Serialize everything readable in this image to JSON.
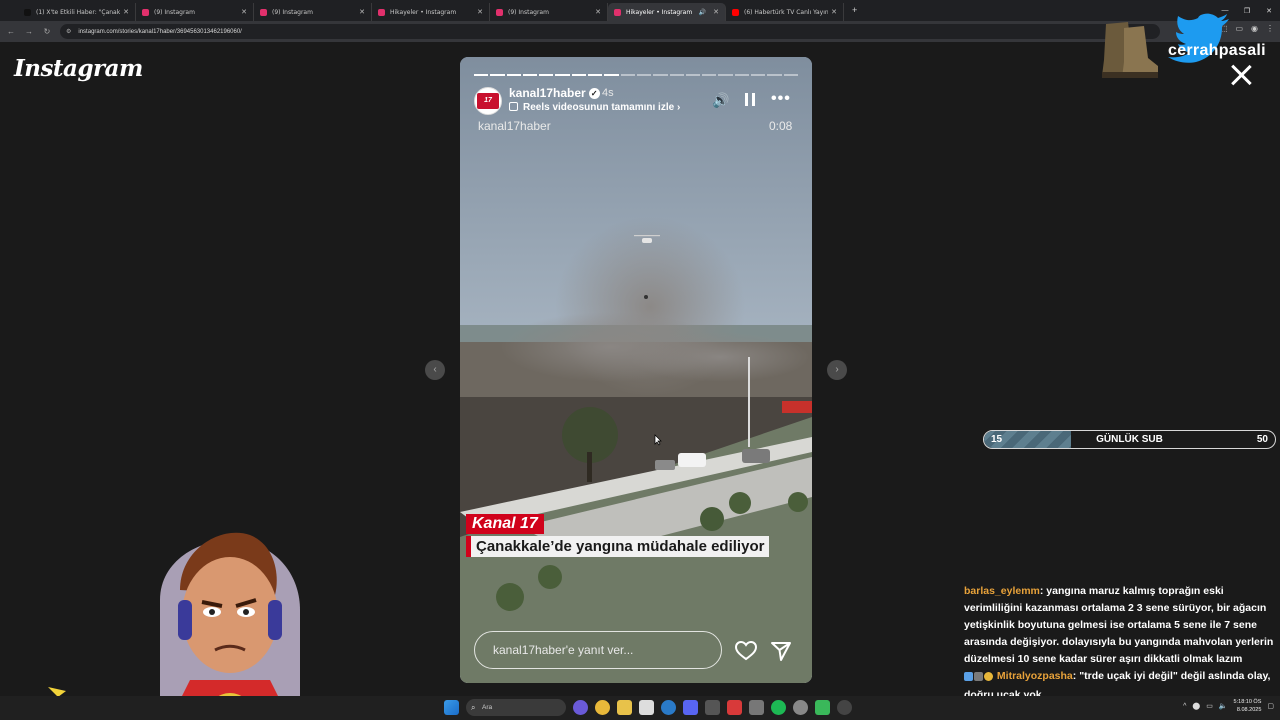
{
  "browser": {
    "tabs": [
      {
        "title": "(1) X'te Etkili Haber: \"Çanakkale",
        "favicon_color": "#111111",
        "active": false
      },
      {
        "title": "(9) Instagram",
        "favicon_color": "#e1306c",
        "active": false
      },
      {
        "title": "(9) Instagram",
        "favicon_color": "#e1306c",
        "active": false
      },
      {
        "title": "Hikayeler • Instagram",
        "favicon_color": "#e1306c",
        "active": false
      },
      {
        "title": "(9) Instagram",
        "favicon_color": "#e1306c",
        "active": false
      },
      {
        "title": "Hikayeler • Instagram",
        "favicon_color": "#e1306c",
        "active": true,
        "audio": true
      },
      {
        "title": "(6) Habertürk TV Canlı Yayın ᴴᴰ",
        "favicon_color": "#ff0000",
        "active": false
      }
    ],
    "new_tab": "+",
    "url": "instagram.com/stories/kanal17haber/3694563013462196060/"
  },
  "instagram": {
    "logo": "Instagram",
    "story": {
      "username": "kanal17haber",
      "avatar_text": "17",
      "time_ago": "4s",
      "reels_link": "Reels videosunun tamamını izle",
      "watermark_user": "kanal17haber",
      "video_time": "0:08",
      "channel_tag": "Kanal 17",
      "headline": "Çanakkale’de yangına müdahale ediliyor",
      "reply_placeholder": "kanal17haber'e yanıt ver...",
      "progress_total": 20,
      "progress_done": 9
    }
  },
  "overlay": {
    "brand_name": "cerrahpasali",
    "sub_goal": {
      "current": "15",
      "label": "GÜNLÜK SUB",
      "goal": "50",
      "fraction": 0.3
    },
    "chat": [
      {
        "user": "barlas_eylemm",
        "message": ": yangına maruz kalmış toprağın eski verimliliğini kazanması ortalama 2 3 sene sürüyor, bir ağacın yetişkinlik boyutuna gelmesi ise ortalama 5 sene ile 7 sene arasında değişiyor. dolayısıyla bu yangında mahvolan yerlerin düzelmesi 10 sene kadar sürer aşırı dikkatli olmak lazım"
      },
      {
        "user": "Mitralyozpasha",
        "message": ": \"trde uçak iyi değil\" değil aslında olay, doğru uçak yok"
      }
    ]
  },
  "taskbar": {
    "search": "Ara",
    "time": "5:18:10 ÖS",
    "date": "8.08.2025",
    "tray_arrow": "^"
  }
}
